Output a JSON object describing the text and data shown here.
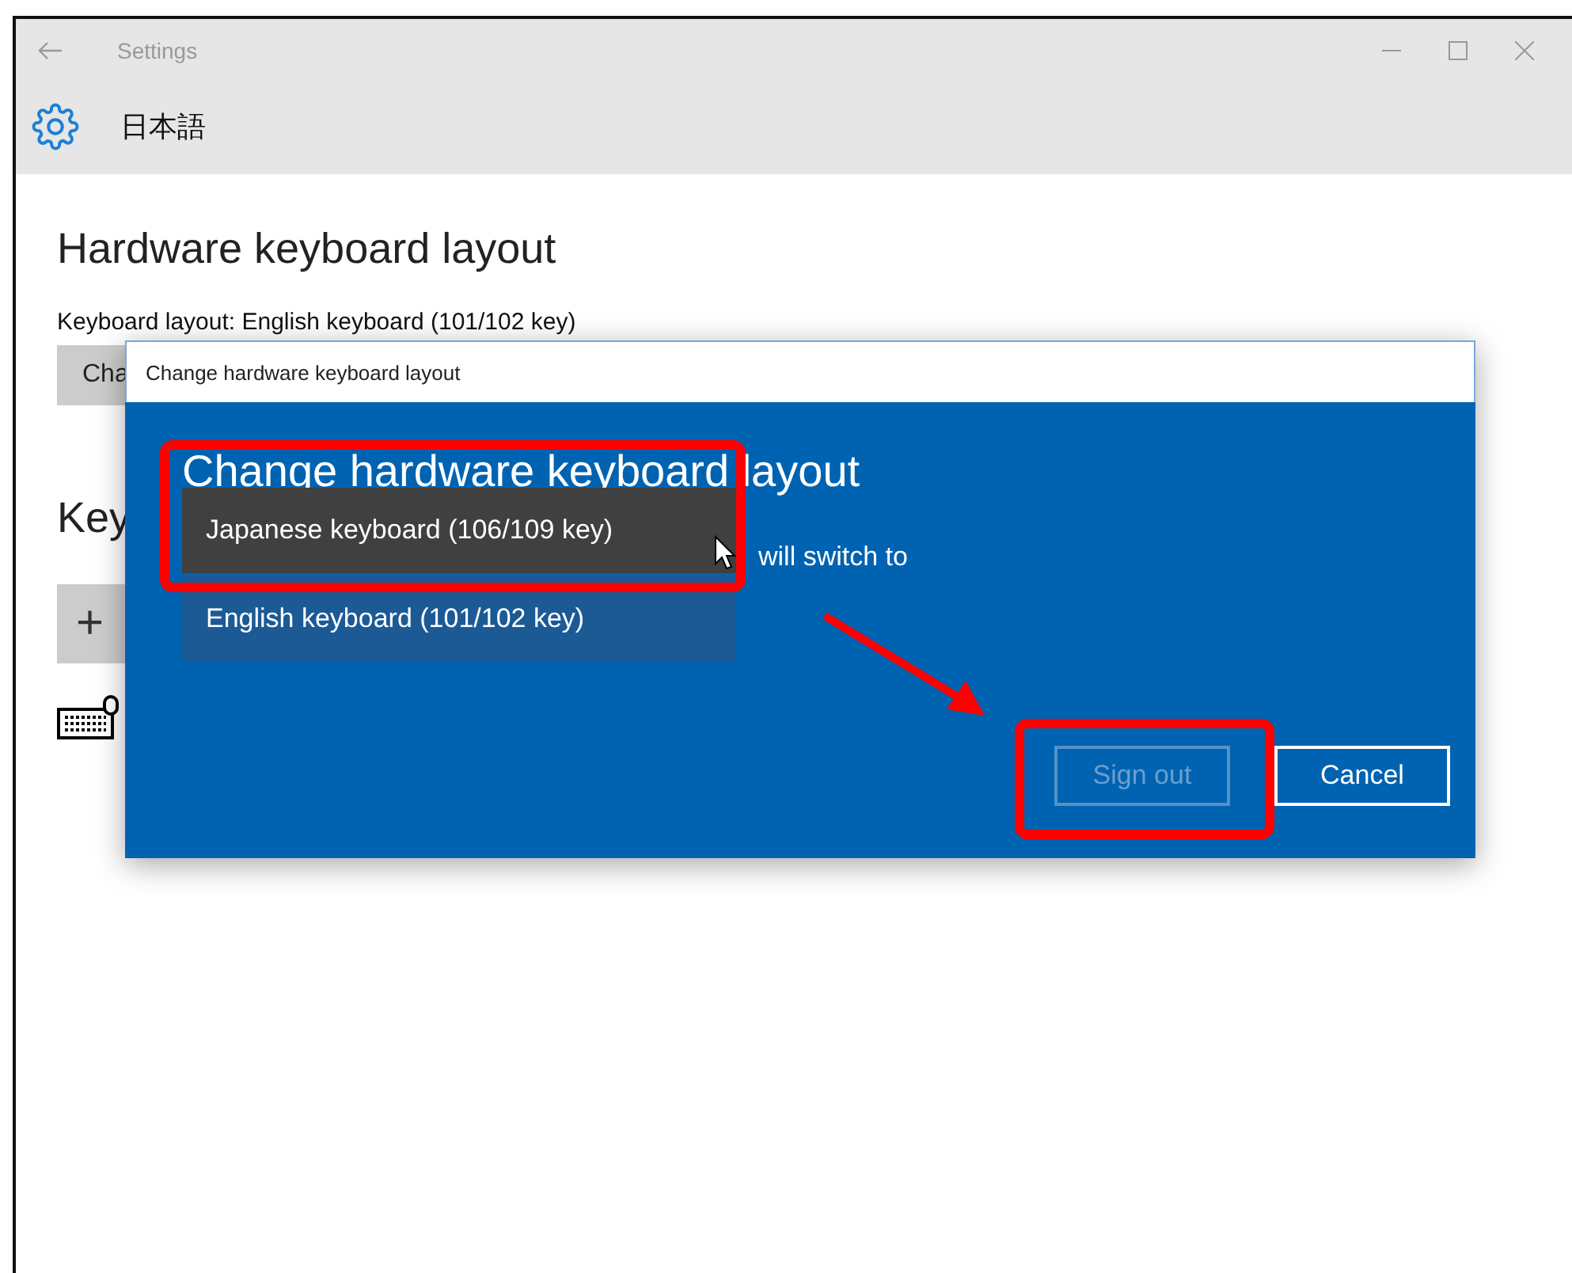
{
  "window": {
    "title": "Settings",
    "page_title": "日本語"
  },
  "content": {
    "heading": "Hardware keyboard layout",
    "layout_label": "Keyboard layout:  English keyboard (101/102 key)",
    "change_button": "Cha",
    "section_heading": "Key",
    "add_button": "+"
  },
  "dialog": {
    "title": "Change hardware keyboard layout",
    "heading": "Change hardware keyboard layout",
    "body": "will switch to",
    "options": [
      {
        "label": "Japanese keyboard (106/109 key)",
        "selected": true
      },
      {
        "label": "English keyboard (101/102 key)",
        "selected": false
      }
    ],
    "buttons": [
      {
        "label": "Sign out",
        "disabled": true
      },
      {
        "label": "Cancel",
        "disabled": false
      }
    ]
  }
}
